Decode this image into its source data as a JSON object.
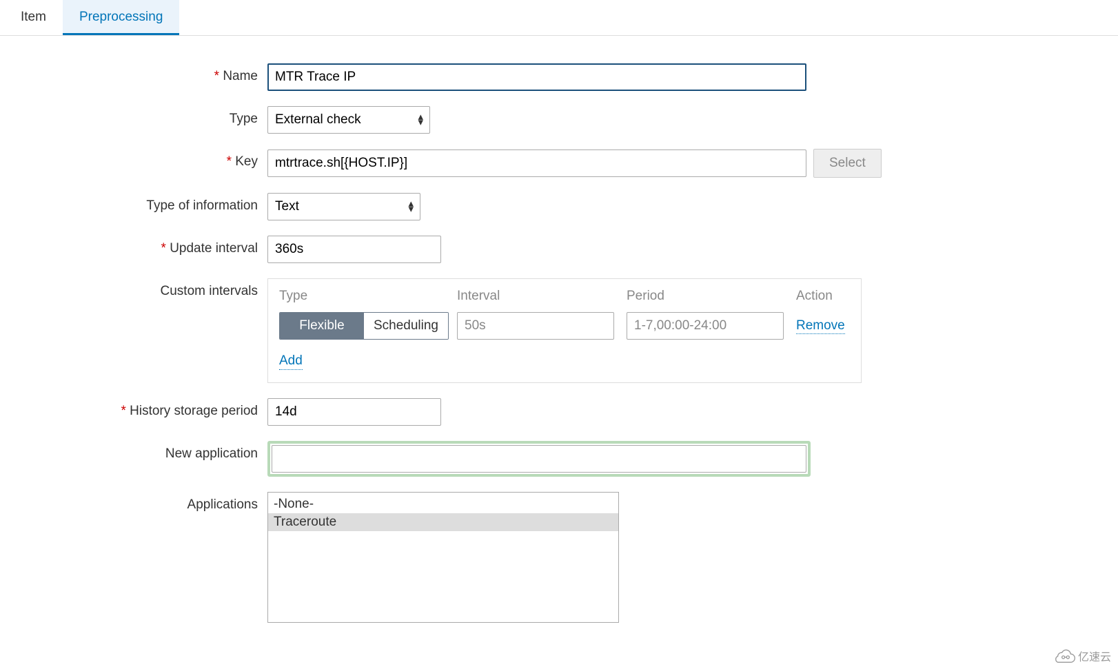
{
  "tabs": {
    "item": "Item",
    "preprocessing": "Preprocessing"
  },
  "labels": {
    "name": "Name",
    "type": "Type",
    "key": "Key",
    "type_of_info": "Type of information",
    "update_interval": "Update interval",
    "custom_intervals": "Custom intervals",
    "history": "History storage period",
    "new_app": "New application",
    "applications": "Applications"
  },
  "values": {
    "name": "MTR Trace IP",
    "type": "External check",
    "key": "mtrtrace.sh[{HOST.IP}]",
    "type_of_info": "Text",
    "update_interval": "360s",
    "history": "14d",
    "new_app": ""
  },
  "buttons": {
    "select": "Select"
  },
  "custom_intervals": {
    "headers": {
      "type": "Type",
      "interval": "Interval",
      "period": "Period",
      "action": "Action"
    },
    "seg_flexible": "Flexible",
    "seg_scheduling": "Scheduling",
    "interval_ph": "50s",
    "period_ph": "1-7,00:00-24:00",
    "remove": "Remove",
    "add": "Add"
  },
  "applications": {
    "options": [
      "-None-",
      "Traceroute"
    ],
    "selected": "Traceroute"
  },
  "watermark": "亿速云"
}
